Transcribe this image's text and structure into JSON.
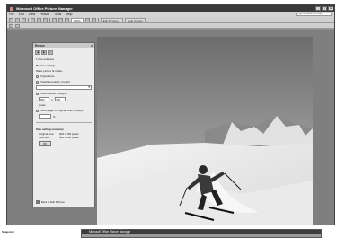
{
  "window": {
    "title": "Microsoft Office Picture Manager",
    "controls": [
      "_",
      "□",
      "x"
    ]
  },
  "menubar": {
    "items": [
      "File",
      "Edit",
      "View",
      "Picture",
      "Tools",
      "Help"
    ],
    "help_placeholder": "Type a question for help"
  },
  "toolbar": {
    "zoom": "100%",
    "edit_pictures_label": "Edit Pictures...",
    "auto_correct_label": "Auto Correct"
  },
  "resize_panel": {
    "title": "Resize",
    "selected_text": "1 files selected",
    "settings_heading": "Resize settings",
    "make_fit_text": "Make picture fit inside:",
    "options": {
      "original": "Original size",
      "predefined": "Predefined width x height:",
      "custom": "Custom width x height:",
      "percentage": "Percentage of original width x height:"
    },
    "width_value": "900",
    "height_value": "600",
    "unit": "pixels",
    "percent_symbol": "%",
    "summary_heading": "Size setting summary",
    "summary": {
      "original_label": "Original size:",
      "original_value": "900 x 600 pixels",
      "new_label": "New size:",
      "new_value": "900 x 600 pixels"
    },
    "ok_label": "OK",
    "footer_link": "Back to Edit Pictures",
    "close_glyph": "x",
    "nav_glyphs": [
      "◀",
      "▶",
      "⌂"
    ]
  },
  "taskbar": {
    "item": "Snapshot",
    "second_window_title": "Microsoft Office Picture Manager"
  }
}
